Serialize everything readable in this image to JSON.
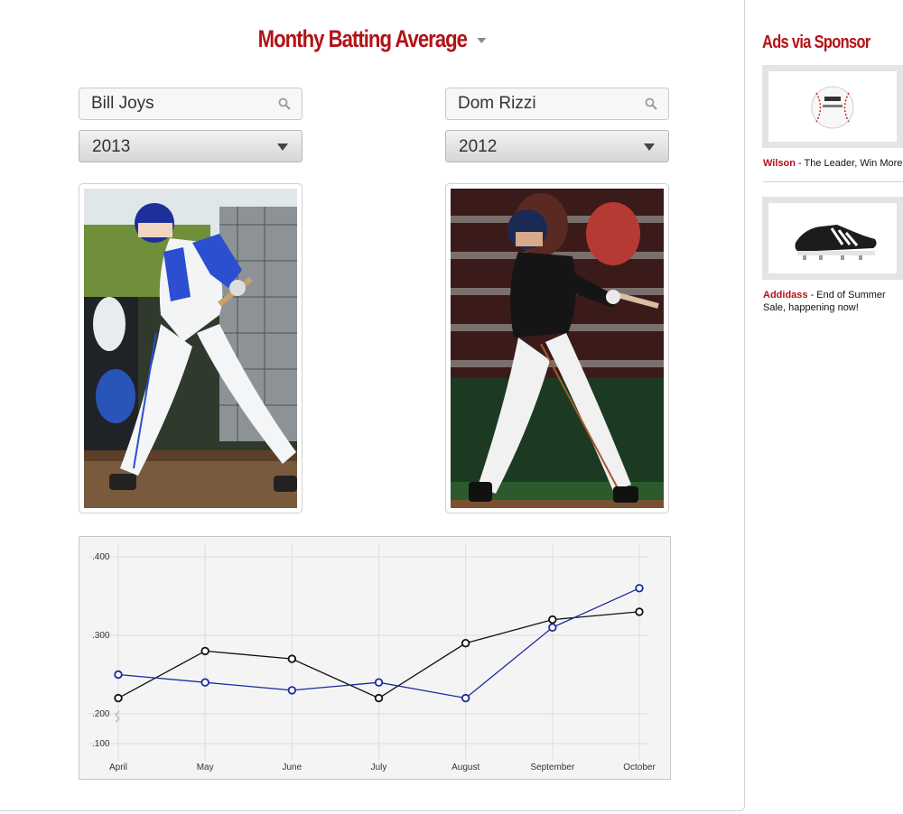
{
  "page": {
    "title": "Monthy Batting Average"
  },
  "players": [
    {
      "name": "Bill Joys",
      "year": "2013"
    },
    {
      "name": "Dom Rizzi",
      "year": "2012"
    }
  ],
  "chart_data": {
    "type": "line",
    "categories": [
      "April",
      "May",
      "June",
      "July",
      "August",
      "September",
      "October"
    ],
    "y_ticks": [
      ".100",
      ".200",
      ".300",
      ".400"
    ],
    "ylim": [
      0.1,
      0.4
    ],
    "axis_break_below": 0.2,
    "grid": true,
    "series": [
      {
        "color": "#111111",
        "values": [
          0.22,
          0.28,
          0.27,
          0.22,
          0.29,
          0.32,
          0.33
        ]
      },
      {
        "color": "#1b2a9e",
        "values": [
          0.25,
          0.24,
          0.23,
          0.24,
          0.22,
          0.31,
          0.36
        ]
      }
    ]
  },
  "sidebar": {
    "title": "Ads via Sponsor",
    "ads": [
      {
        "brand": "Wilson",
        "text": " - The Leader, Win More",
        "image": "baseball-icon"
      },
      {
        "brand": "Addidass",
        "text": " - End of Summer Sale, happening now!",
        "image": "cleat-shoe-icon"
      }
    ]
  },
  "colors": {
    "accent": "#b31217",
    "series_black": "#111111",
    "series_blue": "#1b2a9e"
  }
}
